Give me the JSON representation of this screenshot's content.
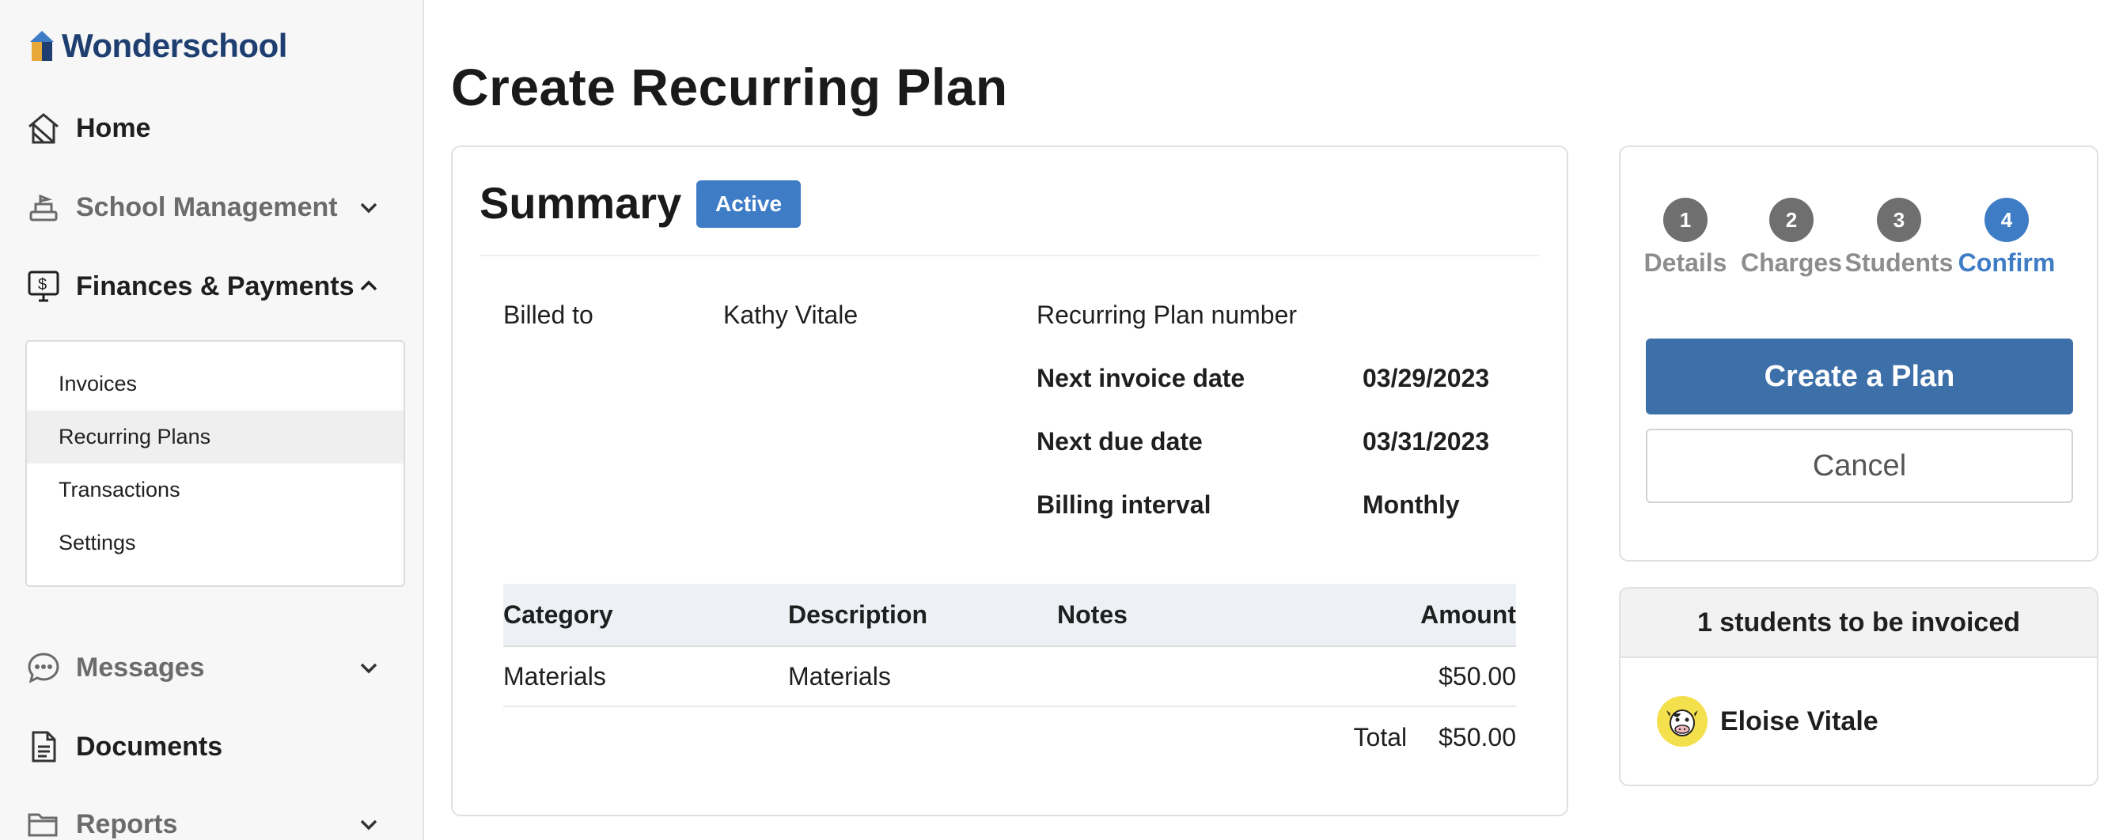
{
  "app": {
    "name": "Wonderschool",
    "brand_color": "#1e3f70",
    "accent_color": "#3f7cc6"
  },
  "sidebar": {
    "items": [
      {
        "label": "Home",
        "icon": "home-icon"
      },
      {
        "label": "School Management",
        "icon": "school-icon",
        "expanded": false
      },
      {
        "label": "Finances & Payments",
        "icon": "finance-icon",
        "expanded": true
      },
      {
        "label": "Messages",
        "icon": "chat-icon",
        "expanded": false
      },
      {
        "label": "Documents",
        "icon": "document-icon"
      },
      {
        "label": "Reports",
        "icon": "folder-icon",
        "expanded": false
      }
    ],
    "finances_subitems": [
      {
        "label": "Invoices"
      },
      {
        "label": "Recurring Plans",
        "active": true
      },
      {
        "label": "Transactions"
      },
      {
        "label": "Settings"
      }
    ]
  },
  "page": {
    "title": "Create Recurring Plan"
  },
  "summary": {
    "title": "Summary",
    "status": "Active",
    "billed_to_label": "Billed to",
    "billed_to_value": "Kathy Vitale",
    "plan_number_label": "Recurring Plan number",
    "next_invoice_label": "Next invoice date",
    "next_invoice_value": "03/29/2023",
    "next_due_label": "Next due date",
    "next_due_value": "03/31/2023",
    "interval_label": "Billing interval",
    "interval_value": "Monthly",
    "table": {
      "headers": [
        "Category",
        "Description",
        "Notes",
        "Amount"
      ],
      "rows": [
        {
          "category": "Materials",
          "description": "Materials",
          "notes": "",
          "amount": "$50.00"
        }
      ],
      "total_label": "Total",
      "total_value": "$50.00"
    }
  },
  "steps": [
    {
      "number": "1",
      "label": "Details",
      "active": false
    },
    {
      "number": "2",
      "label": "Charges",
      "active": false
    },
    {
      "number": "3",
      "label": "Students",
      "active": false
    },
    {
      "number": "4",
      "label": "Confirm",
      "active": true
    }
  ],
  "actions": {
    "primary": "Create a Plan",
    "secondary": "Cancel"
  },
  "students": {
    "header": "1 students to be invoiced",
    "list": [
      {
        "name": "Eloise Vitale",
        "avatar": "cow-avatar"
      }
    ]
  }
}
